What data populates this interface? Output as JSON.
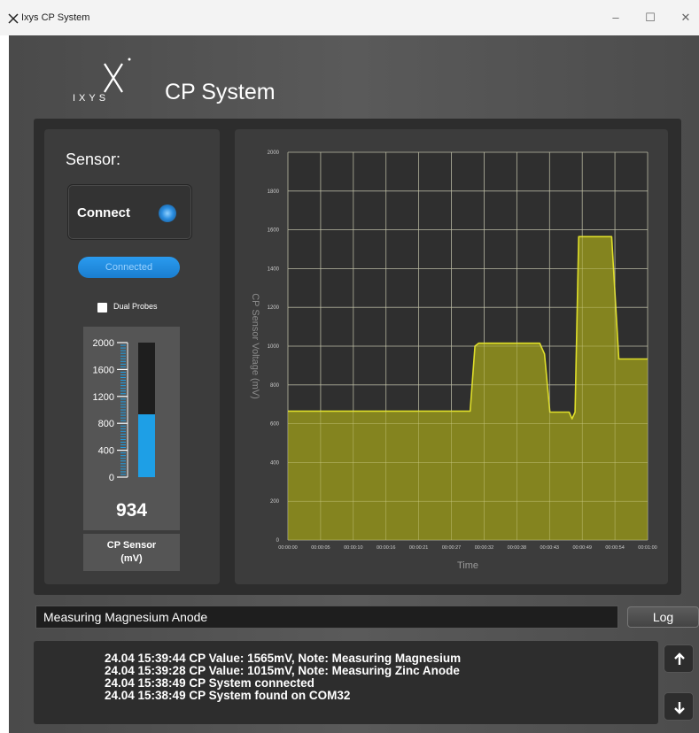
{
  "window": {
    "title": "Ixys CP System",
    "controls": {
      "minimize": "–",
      "maximize": "☐",
      "close": "✕"
    }
  },
  "header": {
    "logo_text": "IXYS",
    "app_title": "CP System"
  },
  "sensor": {
    "heading": "Sensor:",
    "connect_label": "Connect",
    "status": "Connected",
    "led_color": "#2a8de0",
    "dual_probes_label": "Dual Probes",
    "dual_probes_checked": false,
    "gauge": {
      "ticks": [
        "2000",
        "1600",
        "1200",
        "800",
        "400",
        "0"
      ],
      "min": 0,
      "max": 2000,
      "value": 934,
      "value_text": "934",
      "fill_color": "#1e9fe6",
      "caption_line1": "CP Sensor",
      "caption_line2": "(mV)"
    }
  },
  "chart_data": {
    "type": "area",
    "title": "",
    "xlabel": "Time",
    "ylabel": "CP Sensor Voltage (mV)",
    "ylim": [
      0,
      2000
    ],
    "xlim": [
      0,
      60
    ],
    "y_ticks": [
      "0",
      "200",
      "400",
      "600",
      "800",
      "1000",
      "1200",
      "1400",
      "1600",
      "1800",
      "2000"
    ],
    "x_ticks": [
      "00:00:00",
      "00:00:05",
      "00:00:10",
      "00:00:16",
      "00:00:21",
      "00:00:27",
      "00:00:32",
      "00:00:38",
      "00:00:43",
      "00:00:49",
      "00:00:54",
      "00:01:00"
    ],
    "grid": true,
    "fill_color": "#8c8c1e",
    "line_color": "#dede2a",
    "series": [
      {
        "x": [
          0,
          30.4,
          31.2,
          31.8,
          42.0,
          42.8,
          43.7,
          46.9,
          47.4,
          47.9,
          48.5,
          54.0,
          54.5,
          55.2,
          60
        ],
        "y": [
          665,
          665,
          1000,
          1015,
          1015,
          960,
          660,
          660,
          625,
          660,
          1565,
          1565,
          1300,
          934,
          934
        ]
      }
    ]
  },
  "note_field": {
    "value": "Measuring Magnesium Anode"
  },
  "log_button_label": "Log",
  "log": [
    "24.04 15:39:44 CP Value: 1565mV, Note: Measuring Magnesium",
    "24.04 15:39:28 CP Value: 1015mV, Note: Measuring Zinc Anode",
    "24.04 15:38:49 CP System connected",
    "24.04 15:38:49 CP System found on COM32"
  ]
}
